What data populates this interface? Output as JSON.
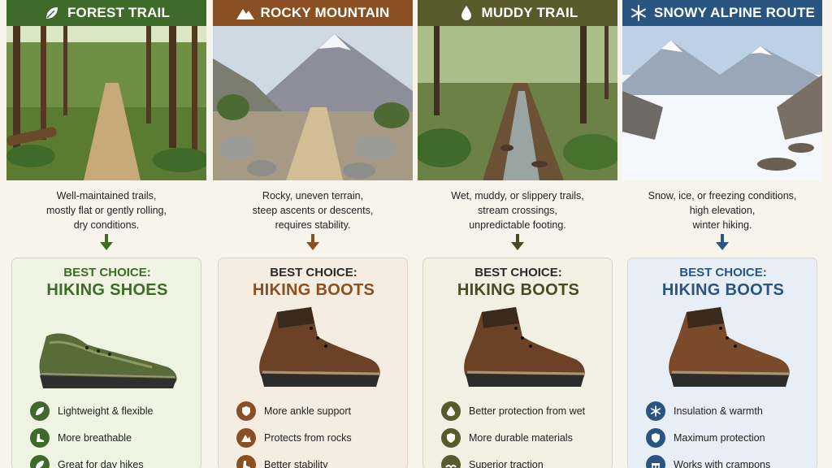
{
  "columns": [
    {
      "title": "FOREST TRAIL",
      "header_icon": "leaf-icon",
      "accent": "#3f6b2a",
      "card_bg": "#eef3e2",
      "description": [
        "Well-maintained trails,",
        "mostly flat or gently rolling,",
        "dry conditions."
      ],
      "best_label": "BEST CHOICE:",
      "choice": "HIKING SHOES",
      "features": [
        {
          "icon": "feather-icon",
          "label": "Lightweight & flexible"
        },
        {
          "icon": "boot-breathable-icon",
          "label": "More breathable"
        },
        {
          "icon": "leaf-icon",
          "label": "Great for day hikes"
        }
      ]
    },
    {
      "title": "ROCKY MOUNTAIN",
      "header_icon": "mountain-icon",
      "accent": "#8a4f22",
      "card_bg": "#f5ede2",
      "description": [
        "Rocky, uneven terrain,",
        "steep ascents or descents,",
        "requires stability."
      ],
      "best_label": "BEST CHOICE:",
      "choice": "HIKING BOOTS",
      "features": [
        {
          "icon": "shield-icon",
          "label": "More ankle support"
        },
        {
          "icon": "mountain-icon",
          "label": "Protects from rocks"
        },
        {
          "icon": "boot-icon",
          "label": "Better stability"
        }
      ]
    },
    {
      "title": "MUDDY TRAIL",
      "header_icon": "droplet-icon",
      "accent": "#5a5a2c",
      "card_bg": "#f2efe3",
      "description": [
        "Wet, muddy, or slippery trails,",
        "stream crossings,",
        "unpredictable footing."
      ],
      "best_label": "BEST CHOICE:",
      "choice": "HIKING BOOTS",
      "features": [
        {
          "icon": "droplet-icon",
          "label": "Better protection from wet"
        },
        {
          "icon": "shield-icon",
          "label": "More durable materials"
        },
        {
          "icon": "traction-icon",
          "label": "Superior traction"
        }
      ]
    },
    {
      "title": "SNOWY ALPINE ROUTE",
      "header_icon": "snowflake-icon",
      "accent": "#2a5580",
      "card_bg": "#e8eef5",
      "description": [
        "Snow, ice, or freezing conditions,",
        "high elevation,",
        "winter hiking."
      ],
      "best_label": "BEST CHOICE:",
      "choice": "HIKING BOOTS",
      "features": [
        {
          "icon": "snowflake-icon",
          "label": "Insulation & warmth"
        },
        {
          "icon": "shield-icon",
          "label": "Maximum protection"
        },
        {
          "icon": "crampon-icon",
          "label": "Works with crampons"
        }
      ]
    }
  ]
}
